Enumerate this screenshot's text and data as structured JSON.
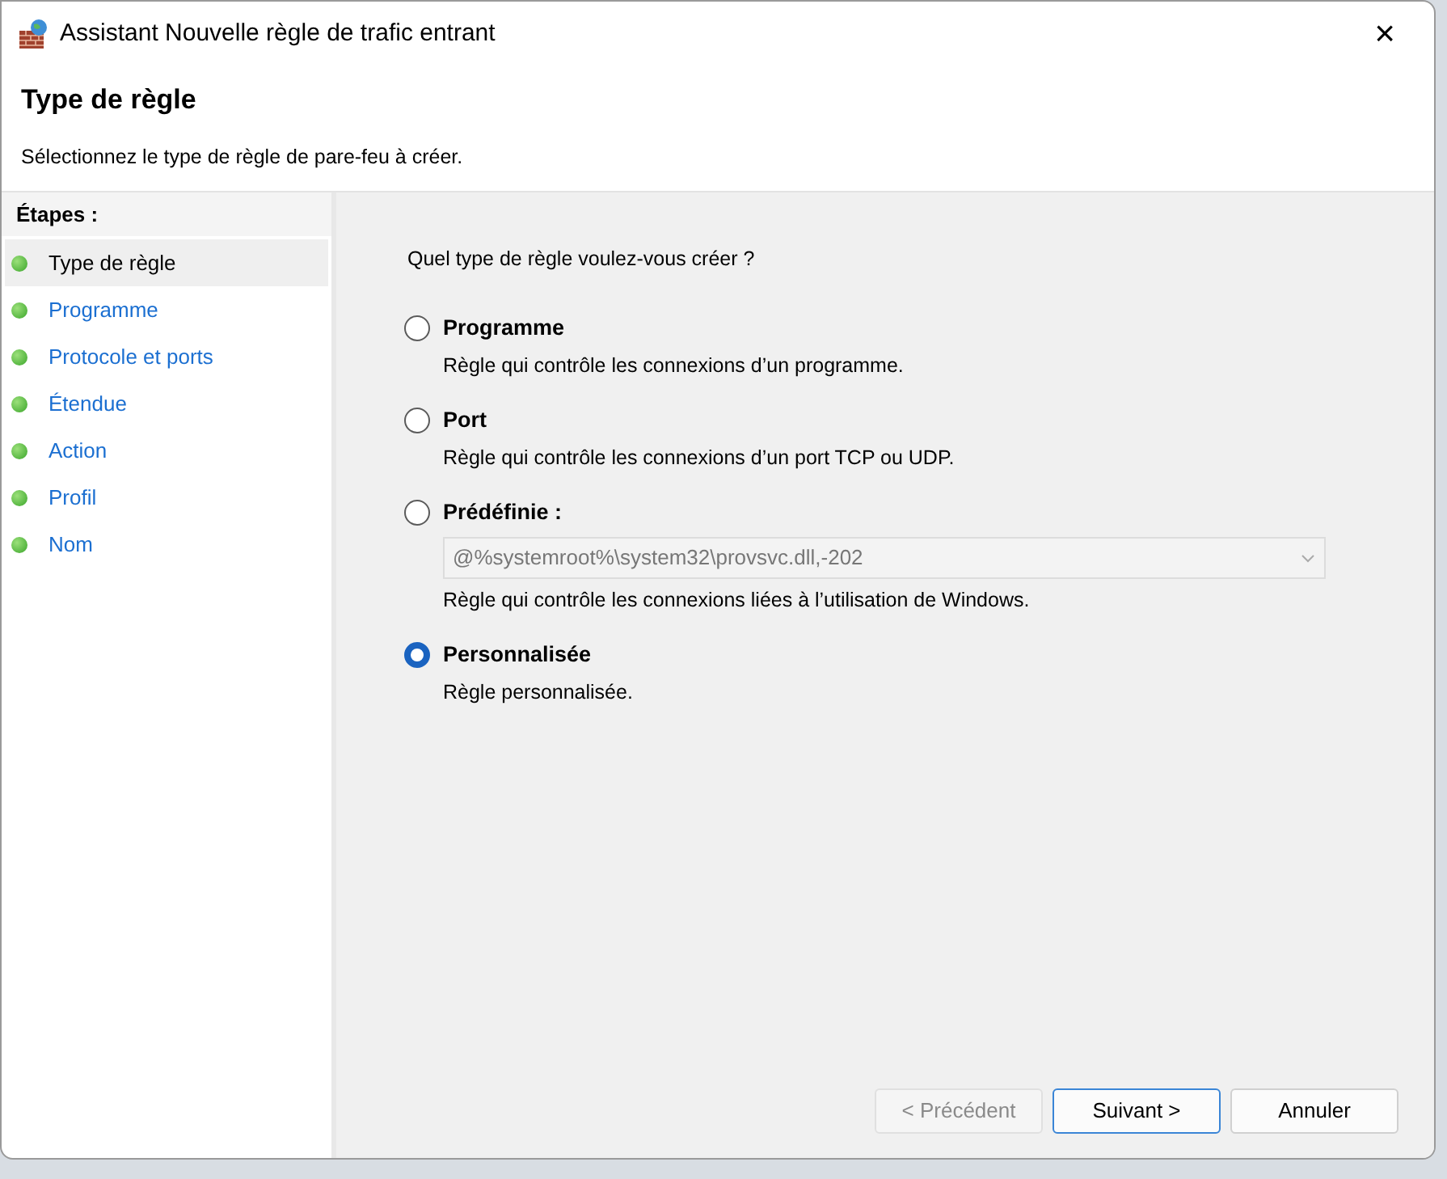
{
  "window": {
    "title": "Assistant Nouvelle règle de trafic entrant",
    "close": "×"
  },
  "header": {
    "title": "Type de règle",
    "subtitle": "Sélectionnez le type de règle de pare-feu à créer."
  },
  "steps": {
    "heading": "Étapes :",
    "items": [
      {
        "label": "Type de règle",
        "selected": true
      },
      {
        "label": "Programme",
        "selected": false
      },
      {
        "label": "Protocole et ports",
        "selected": false
      },
      {
        "label": "Étendue",
        "selected": false
      },
      {
        "label": "Action",
        "selected": false
      },
      {
        "label": "Profil",
        "selected": false
      },
      {
        "label": "Nom",
        "selected": false
      }
    ]
  },
  "question": "Quel type de règle voulez-vous créer ?",
  "options": [
    {
      "label": "Programme",
      "description": "Règle qui contrôle les connexions d’un programme.",
      "selected": false
    },
    {
      "label": "Port",
      "description": "Règle qui contrôle les connexions d’un port TCP ou UDP.",
      "selected": false
    },
    {
      "label": "Prédéfinie :",
      "dropdown": {
        "value": "@%systemroot%\\system32\\provsvc.dll,-202",
        "disabled": true
      },
      "description": "Règle qui contrôle les connexions liées à l’utilisation de Windows.",
      "selected": false
    },
    {
      "label": "Personnalisée",
      "description": "Règle personnalisée.",
      "selected": true
    }
  ],
  "buttons": [
    {
      "label": "< Précédent",
      "disabled": true,
      "default": false
    },
    {
      "label": "Suivant >",
      "disabled": false,
      "default": true
    },
    {
      "label": "Annuler",
      "disabled": false,
      "default": false
    }
  ]
}
